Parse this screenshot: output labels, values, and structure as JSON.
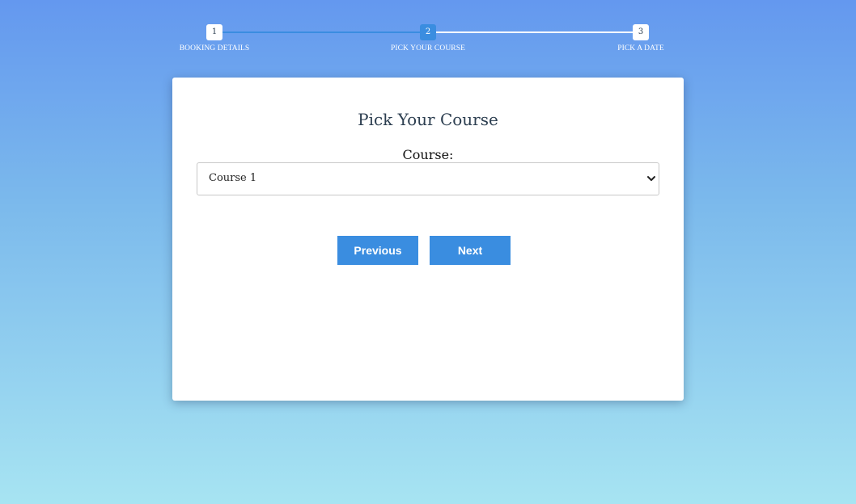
{
  "steps": [
    {
      "number": "1",
      "label": "BOOKING DETAILS"
    },
    {
      "number": "2",
      "label": "PICK YOUR COURSE"
    },
    {
      "number": "3",
      "label": "PICK A DATE"
    }
  ],
  "card": {
    "title": "Pick Your Course",
    "course_label": "Course:",
    "course_value": "Course 1",
    "prev_label": "Previous",
    "next_label": "Next"
  },
  "icons": {
    "select_arrow": "chevron-down-icon"
  },
  "colors": {
    "accent": "#3a8de0",
    "title_text": "#2c3e50",
    "background_top": "#6498ef",
    "background_bottom": "#a7e4f2"
  }
}
